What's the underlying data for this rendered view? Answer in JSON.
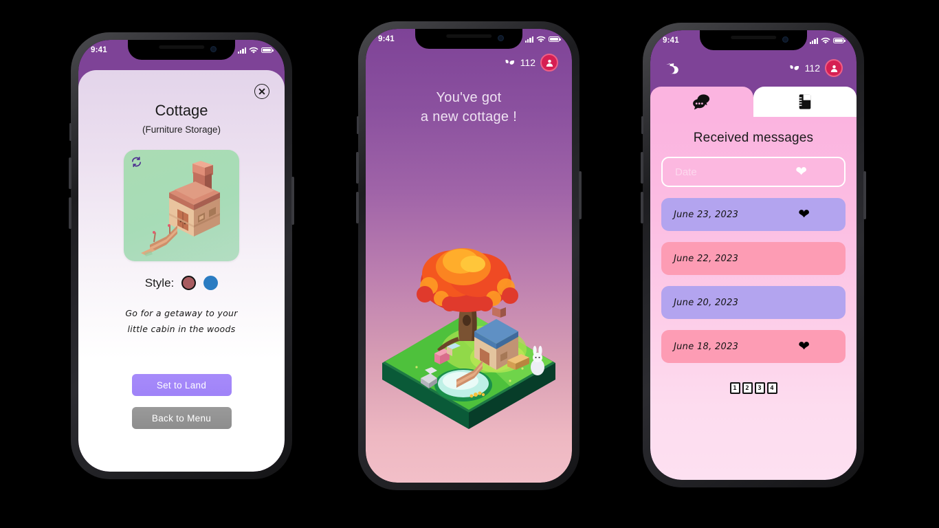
{
  "phones": [
    {
      "name": "cottage-detail",
      "status": {
        "time": "9:41",
        "signal": "signal-bars-icon",
        "wifi": "wifi-icon",
        "battery": "battery-icon"
      },
      "close_label": "close-icon",
      "title": "Cottage",
      "subtitle": "(Furniture Storage)",
      "preview": {
        "rotate_icon": "rotate-icon",
        "item": "cottage-isometric-illustration"
      },
      "style": {
        "label": "Style:",
        "options": [
          {
            "name": "brown",
            "color": "#a85c60",
            "selected": true
          },
          {
            "name": "blue",
            "color": "#2b7cc2",
            "selected": false
          }
        ]
      },
      "description_line1": "Go for a getaway to your",
      "description_line2": "little cabin in the woods",
      "primary_button": "Set to Land",
      "secondary_button": "Back to Menu"
    },
    {
      "name": "new-cottage-reward",
      "status": {
        "time": "9:41"
      },
      "hud": {
        "leaf_icon": "leaf-icon",
        "count": "112",
        "avatar": "user-avatar-icon"
      },
      "headline_line1": "You've got",
      "headline_line2": "a new cottage !",
      "illustration": "island-with-tree-and-cottage"
    },
    {
      "name": "received-messages",
      "status": {
        "time": "9:41"
      },
      "back_icon": "back-arrow-icon",
      "hud": {
        "leaf_icon": "leaf-icon",
        "count": "112",
        "avatar": "user-avatar-icon"
      },
      "tabs": [
        {
          "name": "messages",
          "icon": "chat-bubbles-icon",
          "active": true
        },
        {
          "name": "notebook",
          "icon": "notebook-icon",
          "active": false
        }
      ],
      "title": "Received messages",
      "filter": {
        "label": "Date",
        "heart_icon": "heart-icon"
      },
      "messages": [
        {
          "date": "June 23, 2023",
          "bg": "#b3a4ef",
          "favorite": true
        },
        {
          "date": "June 22, 2023",
          "bg": "#fd9cb4",
          "favorite": false
        },
        {
          "date": "June 20, 2023",
          "bg": "#b3a4ef",
          "favorite": false
        },
        {
          "date": "June 18, 2023",
          "bg": "#fd9cb4",
          "favorite": true
        }
      ],
      "pagination": [
        "1",
        "2",
        "3",
        "4"
      ]
    }
  ],
  "colors": {
    "purple_header": "#7e4397",
    "accent_purple": "#a78bfa",
    "pink_tab": "#fbb4e0",
    "avatar_red": "#d61f53"
  }
}
